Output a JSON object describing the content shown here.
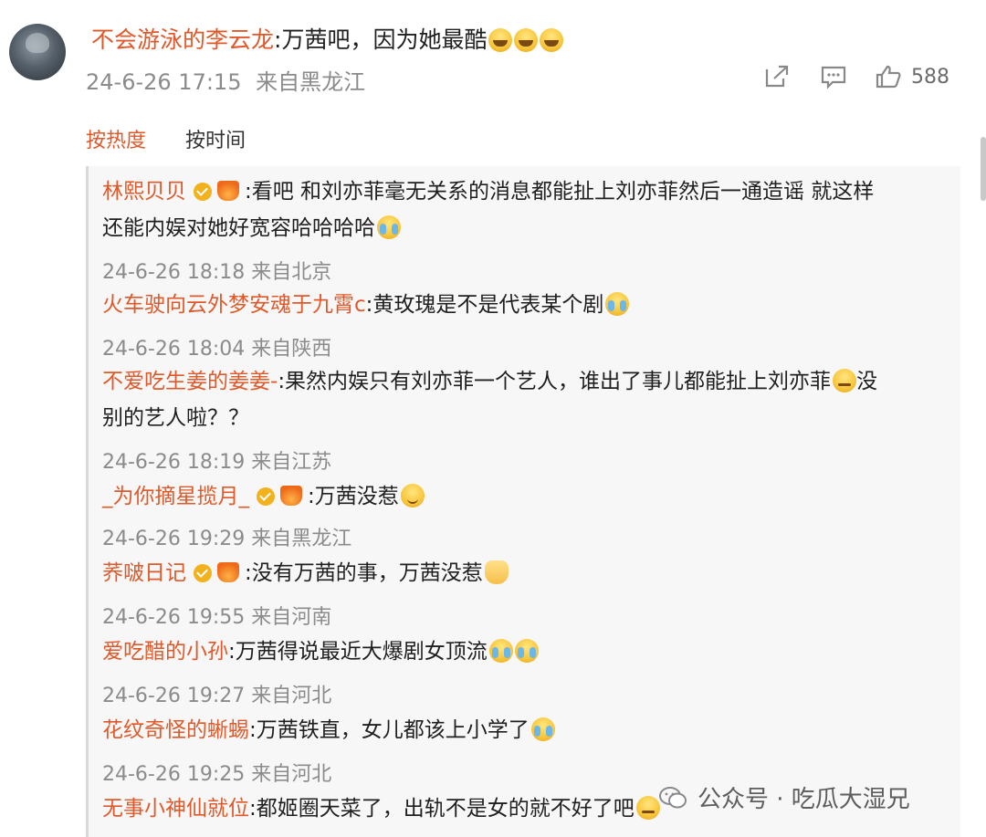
{
  "comment": {
    "username": "不会游泳的李云龙",
    "text": ":万茜吧，因为她最酷",
    "date": "24-6-26 17:15",
    "location": "来自黑龙江",
    "likes": "588",
    "emojis": [
      "laugh-emoji",
      "laugh-emoji",
      "laugh-emoji"
    ]
  },
  "sort": {
    "hot": "按热度",
    "time": "按时间"
  },
  "replies": [
    {
      "username": "林熙贝贝",
      "text": ":看吧 和刘亦菲毫无关系的消息都能扯上刘亦菲然后一通造谣 就这样",
      "text2": "还能内娱对她好宽容哈哈哈哈",
      "date": "24-6-26 18:18",
      "location": "来自北京"
    },
    {
      "username": "火车驶向云外梦安魂于九霄c",
      "text": ":黄玫瑰是不是代表某个剧",
      "date": "24-6-26 18:04",
      "location": "来自陕西"
    },
    {
      "username": "不爱吃生姜的姜姜-",
      "text": ":果然内娱只有刘亦菲一个艺人，谁出了事儿都能扯上刘亦菲",
      "text_end": "没",
      "text2": "别的艺人啦？？",
      "date": "24-6-26 18:19",
      "location": "来自江苏"
    },
    {
      "username": "_为你摘星揽月_",
      "text": ":万茜没惹",
      "date": "24-6-26 19:29",
      "location": "来自黑龙江"
    },
    {
      "username": "荞啵日记",
      "text": ":没有万茜的事，万茜没惹",
      "date": "24-6-26 19:55",
      "location": "来自河南"
    },
    {
      "username": "爱吃醋的小孙",
      "text": ":万茜得说最近大爆剧女顶流",
      "date": "24-6-26 19:27",
      "location": "来自河北"
    },
    {
      "username": "花纹奇怪的蜥蜴",
      "text": ":万茜铁直，女儿都该上小学了",
      "date": "24-6-26 19:25",
      "location": "来自河北"
    },
    {
      "username": "无事小神仙就位",
      "text": ":都姬圈天菜了，出轨不是女的就不好了吧",
      "date": "",
      "location": ""
    }
  ],
  "watermark": {
    "text": "公众号 · 吃瓜大湿兄"
  }
}
